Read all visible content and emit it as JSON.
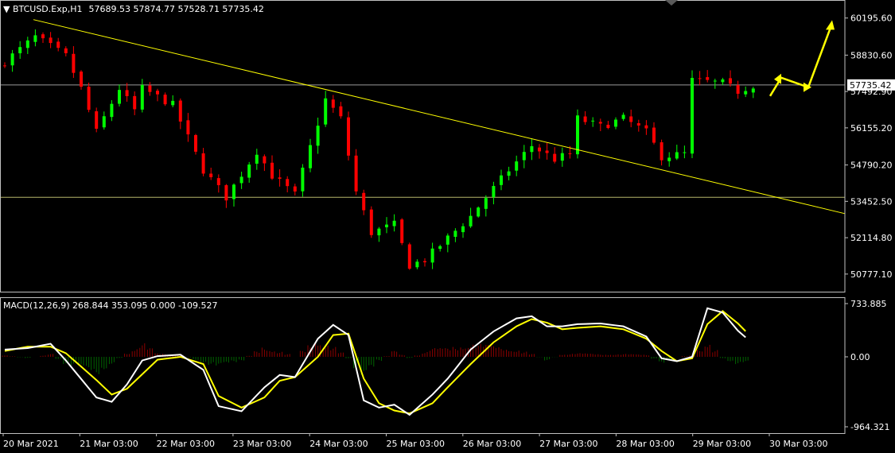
{
  "header": {
    "symbol": "BTCUSD.Exp,H1",
    "ohlc": "57689.53 57874.77 57528.71 57735.42"
  },
  "price_axis": {
    "ticks": [
      "60195.60",
      "58830.60",
      "57492.90",
      "56155.20",
      "54790.20",
      "53452.50",
      "52114.80",
      "50777.10"
    ],
    "ylim": [
      50100,
      60800
    ],
    "current_price": "57735.42"
  },
  "macd_panel": {
    "title": "MACD(12,26,9) 268.844 353.095 0.000 -109.527",
    "ticks": [
      "733.885",
      "0.00",
      "-964.321"
    ],
    "ylim": [
      -964.321,
      733.885
    ]
  },
  "time_axis": {
    "labels": [
      "20 Mar 2021",
      "21 Mar 03:00",
      "22 Mar 03:00",
      "23 Mar 03:00",
      "24 Mar 03:00",
      "25 Mar 03:00",
      "26 Mar 03:00",
      "27 Mar 03:00",
      "28 Mar 03:00",
      "29 Mar 03:00",
      "30 Mar 03:00"
    ]
  },
  "colors": {
    "background": "#000000",
    "bull": "#00ff00",
    "bear": "#ff0000",
    "macd_main": "#ffffff",
    "macd_signal": "#ffff00",
    "hist_positive": "#8b0000",
    "hist_negative": "#006400",
    "trendline": "#ffff00",
    "arrow": "#ffff00",
    "grid": "#c0c0c0"
  },
  "chart_data": [
    {
      "type": "candlestick",
      "title": "BTCUSD.Exp,H1",
      "timeframe": "H1",
      "x_start": "2021-03-20",
      "x_end": "2021-03-30",
      "close_path": [
        [
          0,
          58600
        ],
        [
          4,
          59500
        ],
        [
          8,
          58800
        ],
        [
          10,
          57600
        ],
        [
          12,
          56000
        ],
        [
          15,
          57600
        ],
        [
          17,
          56800
        ],
        [
          18,
          57600
        ],
        [
          22,
          57000
        ],
        [
          26,
          54600
        ],
        [
          29,
          53600
        ],
        [
          33,
          55300
        ],
        [
          35,
          54400
        ],
        [
          38,
          53700
        ],
        [
          42,
          57200
        ],
        [
          44,
          56500
        ],
        [
          46,
          53800
        ],
        [
          48,
          52300
        ],
        [
          51,
          52600
        ],
        [
          53,
          51100
        ],
        [
          55,
          51300
        ],
        [
          58,
          52100
        ],
        [
          61,
          52900
        ],
        [
          63,
          53600
        ],
        [
          66,
          54600
        ],
        [
          69,
          55500
        ],
        [
          72,
          55000
        ],
        [
          74,
          55200
        ],
        [
          75,
          56500
        ],
        [
          78,
          56200
        ],
        [
          81,
          56500
        ],
        [
          84,
          56000
        ],
        [
          86,
          55100
        ],
        [
          89,
          55200
        ],
        [
          90,
          57900
        ],
        [
          94,
          57800
        ],
        [
          96,
          57500
        ],
        [
          98,
          57735.42
        ]
      ],
      "trendline": {
        "from": [
          "20 Mar 2021",
          60195.6
        ],
        "to": [
          "30 Mar 03:00",
          53000
        ]
      },
      "horizontal_levels": [
        57735.42,
        53600
      ],
      "forecast_arrow": [
        57735.42,
        58000,
        57650,
        60000
      ]
    },
    {
      "type": "line",
      "title": "MACD(12,26,9) 268.844 353.095 0.000 -109.527",
      "params": [
        12,
        26,
        9
      ],
      "values": {
        "main": 268.844,
        "signal": 353.095,
        "histogram_ref": 0.0,
        "difference": -109.527
      },
      "main_path": [
        [
          0,
          100
        ],
        [
          3,
          120
        ],
        [
          6,
          180
        ],
        [
          8,
          -50
        ],
        [
          12,
          -560
        ],
        [
          14,
          -620
        ],
        [
          16,
          -380
        ],
        [
          18,
          -50
        ],
        [
          20,
          10
        ],
        [
          23,
          30
        ],
        [
          26,
          -180
        ],
        [
          28,
          -680
        ],
        [
          31,
          -750
        ],
        [
          34,
          -420
        ],
        [
          36,
          -250
        ],
        [
          38,
          -280
        ],
        [
          41,
          250
        ],
        [
          43,
          440
        ],
        [
          45,
          300
        ],
        [
          47,
          -600
        ],
        [
          49,
          -700
        ],
        [
          51,
          -660
        ],
        [
          53,
          -800
        ],
        [
          56,
          -520
        ],
        [
          58,
          -300
        ],
        [
          61,
          100
        ],
        [
          64,
          350
        ],
        [
          67,
          530
        ],
        [
          69,
          560
        ],
        [
          71,
          420
        ],
        [
          73,
          420
        ],
        [
          75,
          450
        ],
        [
          78,
          460
        ],
        [
          81,
          420
        ],
        [
          84,
          280
        ],
        [
          86,
          -20
        ],
        [
          88,
          -60
        ],
        [
          90,
          0
        ],
        [
          92,
          670
        ],
        [
          94,
          610
        ],
        [
          96,
          360
        ],
        [
          97,
          268.844
        ]
      ],
      "signal_path": [
        [
          0,
          80
        ],
        [
          3,
          140
        ],
        [
          6,
          140
        ],
        [
          8,
          50
        ],
        [
          12,
          -320
        ],
        [
          14,
          -520
        ],
        [
          16,
          -440
        ],
        [
          18,
          -240
        ],
        [
          20,
          -40
        ],
        [
          23,
          0
        ],
        [
          26,
          -100
        ],
        [
          28,
          -540
        ],
        [
          31,
          -700
        ],
        [
          34,
          -560
        ],
        [
          36,
          -330
        ],
        [
          38,
          -280
        ],
        [
          41,
          0
        ],
        [
          43,
          300
        ],
        [
          45,
          320
        ],
        [
          47,
          -300
        ],
        [
          49,
          -640
        ],
        [
          51,
          -740
        ],
        [
          53,
          -780
        ],
        [
          56,
          -640
        ],
        [
          58,
          -420
        ],
        [
          61,
          -100
        ],
        [
          64,
          200
        ],
        [
          67,
          420
        ],
        [
          69,
          520
        ],
        [
          71,
          470
        ],
        [
          73,
          380
        ],
        [
          75,
          400
        ],
        [
          78,
          420
        ],
        [
          81,
          380
        ],
        [
          84,
          250
        ],
        [
          86,
          80
        ],
        [
          88,
          -60
        ],
        [
          90,
          -20
        ],
        [
          92,
          450
        ],
        [
          94,
          630
        ],
        [
          96,
          460
        ],
        [
          97,
          353.095
        ]
      ]
    }
  ]
}
